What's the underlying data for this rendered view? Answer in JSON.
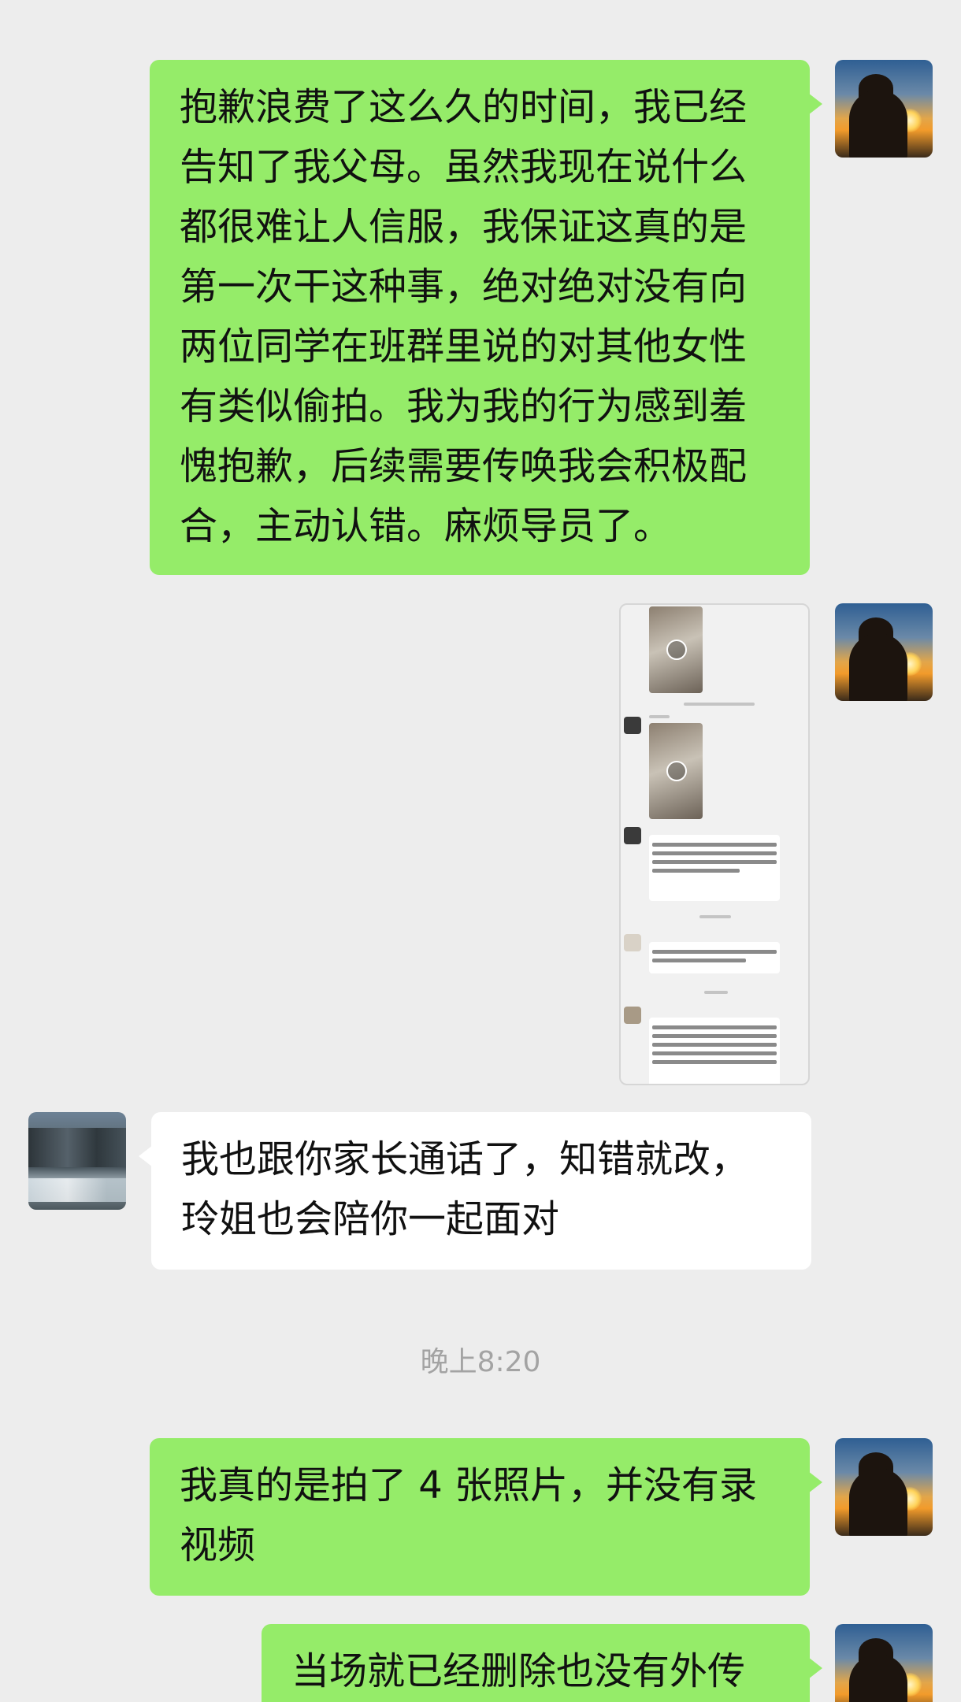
{
  "messages": [
    {
      "side": "right",
      "text": "抱歉浪费了这么久的时间，我已经告知了我父母。虽然我现在说什么都很难让人信服，我保证这真的是第一次干这种事，绝对绝对没有向两位同学在班群里说的对其他女性有类似偷拍。我为我的行为感到羞愧抱歉，后续需要传唤我会积极配合，主动认错。麻烦导员了。",
      "lines": [
        "抱歉浪费了这么久的时间，我已经",
        "告知了我父母。虽然我现在说什么",
        "都很难让人信服，我保证这真的是",
        "第一次干这种事，绝对绝对没有向",
        "两位同学在班群里说的对其他女性",
        "有类似偷拍。我为我的行为感到羞",
        "愧抱歉，后续需要传唤我会积极配",
        "合，主动认错。麻烦导员了。"
      ]
    },
    {
      "side": "right",
      "type": "screenshot-image"
    },
    {
      "side": "left",
      "lines": [
        "我也跟你家长通话了，知错就改，",
        "玲姐也会陪你一起面对"
      ]
    },
    {
      "side": "right",
      "lines": [
        "我真的是拍了 4 张照片，并没有录",
        "视频"
      ]
    },
    {
      "side": "right",
      "lines": [
        "当场就已经删除也没有外传"
      ]
    }
  ],
  "timestamp": "晚上8:20",
  "colors": {
    "background": "#ededed",
    "sent_bubble": "#95ec69",
    "received_bubble": "#ffffff",
    "timestamp": "#a3a3a3"
  },
  "icons": {
    "self_avatar": "sunset-silhouette-avatar",
    "other_avatar": "coastal-rock-avatar",
    "video_play": "play-icon"
  }
}
